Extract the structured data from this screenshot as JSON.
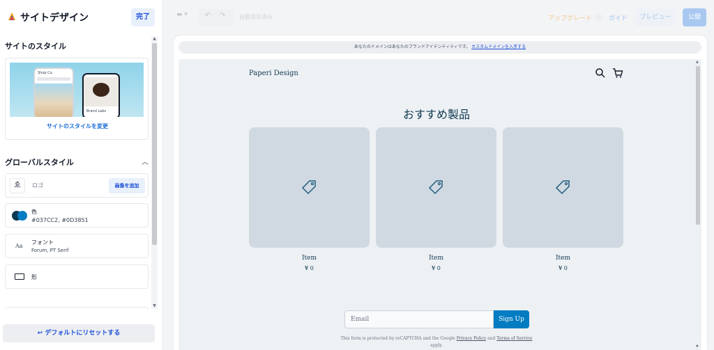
{
  "sidebar": {
    "title": "サイトデザイン",
    "done_label": "完了",
    "site_style": {
      "heading": "サイトのスタイル",
      "change_link": "サイトのスタイルを変更",
      "phone1_text": "Shop Co.",
      "phone2_text": "Brand Labs"
    },
    "global_styles": {
      "heading": "グローバルスタイル",
      "logo_label": "ロゴ",
      "add_image_label": "画像を追加",
      "color_label": "色",
      "color_values": "#037CC2, #0D3851",
      "font_label": "フォント",
      "font_values": "Forum, PT Serif",
      "shape_label": "形"
    },
    "reset_label": "デフォルトにリセットする"
  },
  "toolbar": {
    "autosave": "自動保存済み",
    "upgrade": "アップグレード",
    "guide": "ガイド",
    "preview": "プレビュー",
    "publish": "公開"
  },
  "preview": {
    "domain_notice": "あなたのドメインはあなたのブランドアイデンティティです。",
    "domain_link": "カスタムドメインを入手する",
    "site_name": "Paperi Design",
    "featured_title": "おすすめ製品",
    "products": [
      {
        "name": "Item",
        "price": "¥ 0"
      },
      {
        "name": "Item",
        "price": "¥ 0"
      },
      {
        "name": "Item",
        "price": "¥ 0"
      }
    ],
    "email_placeholder": "Email",
    "signup_label": "Sign Up",
    "recaptcha_prefix": "This form is protected by reCAPTCHA and the Google",
    "privacy_link": "Privacy Policy",
    "and_text": "and",
    "terms_link": "Terms of Service",
    "apply_text": "apply."
  },
  "colors": {
    "primary": "#037CC2",
    "dark": "#0D3851",
    "accent_blue": "#1d4ed8"
  },
  "icons": {
    "brand": "paint-palette-icon",
    "search": "search-icon",
    "cart": "cart-icon",
    "tag": "price-tag-icon"
  }
}
